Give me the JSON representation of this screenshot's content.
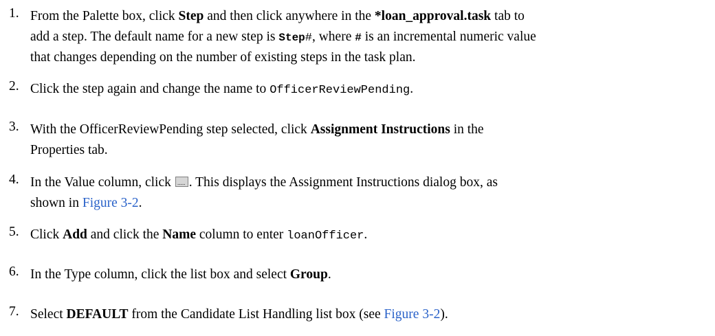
{
  "steps": [
    {
      "num": "1.",
      "lines": [
        [
          "From the Palette box, click ",
          "Step",
          " and then click anywhere in the ",
          "*loan_approval.task",
          " tab to"
        ],
        [
          "add a step. The default name for a new step is ",
          "Step",
          "#",
          ", where ",
          "#",
          " is an incremental numeric value"
        ],
        [
          "that changes depending on the number of existing steps in the task plan."
        ]
      ]
    },
    {
      "num": "2.",
      "lines": [
        [
          "Click the step again and change the name to ",
          "OfficerReviewPending",
          "."
        ]
      ]
    },
    {
      "num": "3.",
      "lines": [
        [
          "With the OfficerReviewPending step selected, click ",
          "Assignment Instructions",
          " in the"
        ],
        [
          "Properties tab."
        ]
      ]
    },
    {
      "num": "4.",
      "icon": "ellipsis-button-icon",
      "lines": [
        [
          "In the Value column, click ",
          ". This displays the Assignment Instructions dialog box, as"
        ],
        [
          "shown in ",
          "Figure 3-2",
          "."
        ]
      ]
    },
    {
      "num": "5.",
      "lines": [
        [
          "Click ",
          "Add",
          " and click the ",
          "Name",
          " column to enter ",
          "loanOfficer",
          "."
        ]
      ]
    },
    {
      "num": "6.",
      "lines": [
        [
          "In the Type column, click the list box and select ",
          "Group",
          "."
        ]
      ]
    },
    {
      "num": "7.",
      "lines": [
        [
          "Select ",
          "DEFAULT",
          " from the Candidate List Handling list box (see ",
          "Figure 3-2",
          ")."
        ]
      ]
    }
  ],
  "colors": {
    "link": "#2a62c9",
    "text": "#000000"
  }
}
